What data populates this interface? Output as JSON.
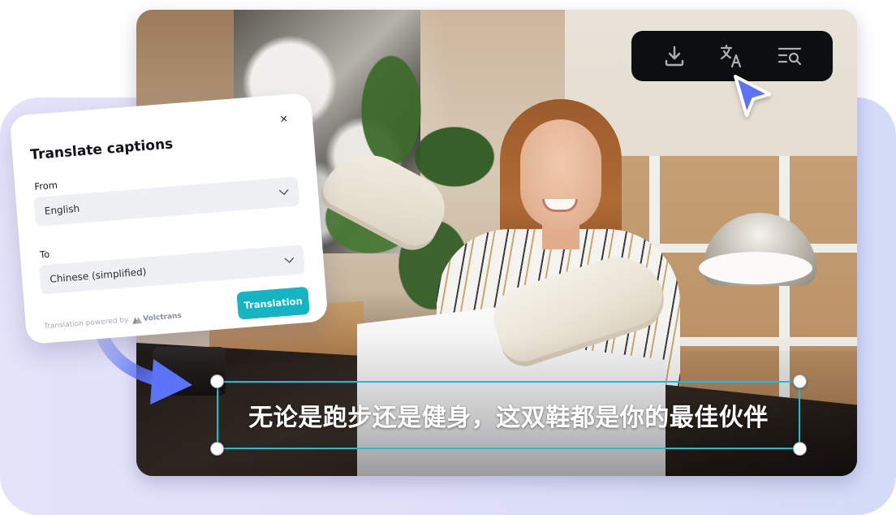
{
  "dialog": {
    "title": "Translate captions",
    "close_label": "×",
    "from_label": "From",
    "from_value": "English",
    "to_label": "To",
    "to_value": "Chinese (simplified)",
    "powered_by_text": "Translation powered by",
    "brand_name": "Volctrans",
    "translate_button_label": "Translation"
  },
  "toolbar": {
    "buttons": [
      {
        "name": "download",
        "icon": "download-icon"
      },
      {
        "name": "translate",
        "icon": "translate-icon"
      },
      {
        "name": "search-captions",
        "icon": "text-search-icon"
      }
    ]
  },
  "caption": {
    "text": "无论是跑步还是健身，这双鞋都是你的最佳伙伴"
  },
  "colors": {
    "accent_teal": "#13b5c3",
    "caption_border": "#12c2d6",
    "cursor_blue": "#5b73f7",
    "toolbar_bg": "#0d0e10",
    "panel_bg": "#e2e0fa"
  }
}
